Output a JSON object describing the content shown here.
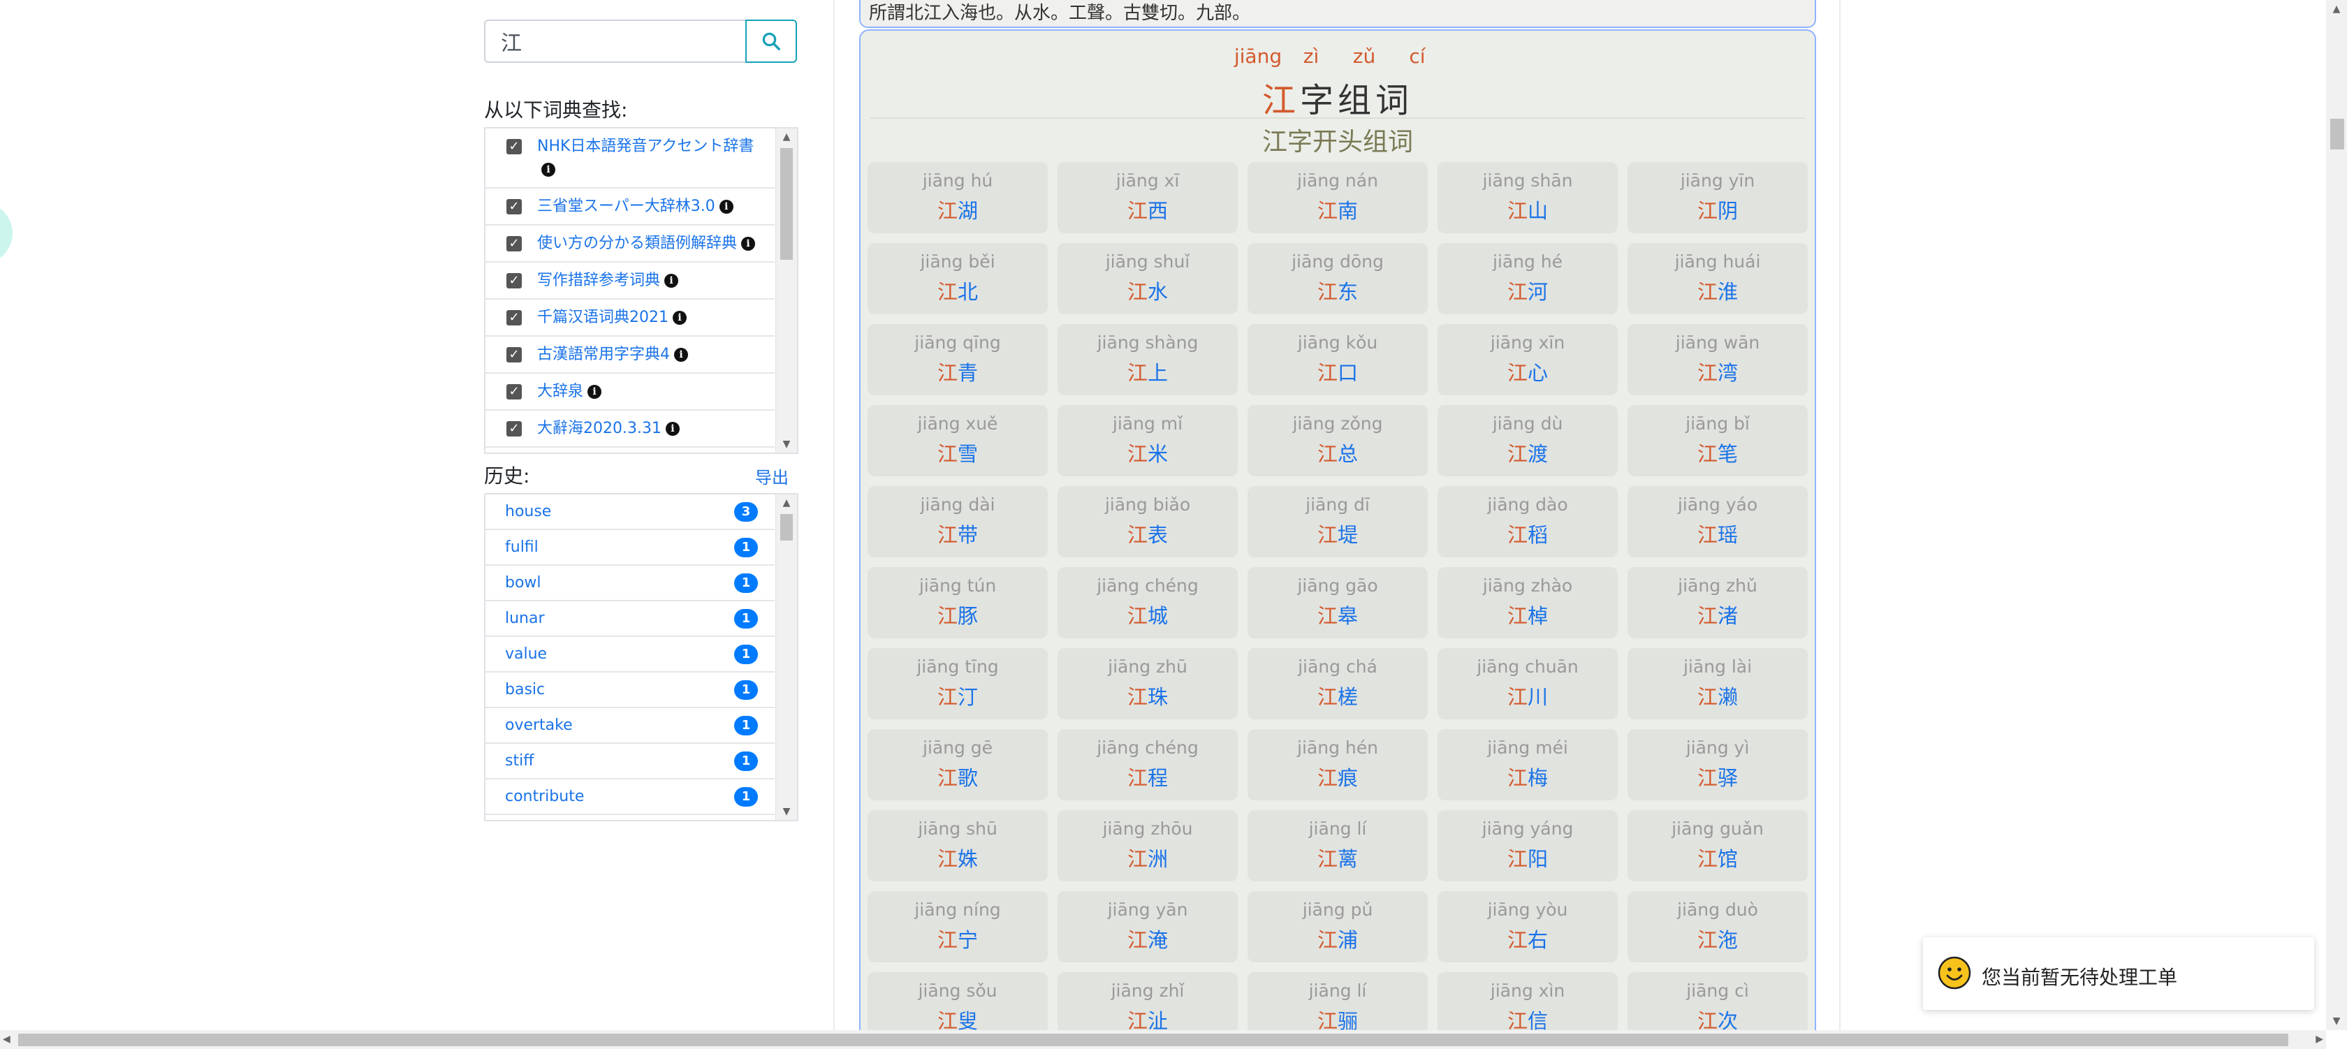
{
  "search": {
    "value": "江",
    "placeholder": "",
    "button_icon": "search-icon"
  },
  "dictionaries": {
    "label": "从以下词典查找:",
    "items": [
      {
        "name": "NHK日本語発音アクセント辞書",
        "checked": true
      },
      {
        "name": "三省堂スーパー大辞林3.0",
        "checked": true
      },
      {
        "name": "使い方の分かる類語例解辞典",
        "checked": true
      },
      {
        "name": "写作措辞参考词典",
        "checked": true
      },
      {
        "name": "千篇汉语词典2021",
        "checked": true
      },
      {
        "name": "古漢語常用字字典4",
        "checked": true
      },
      {
        "name": "大辞泉",
        "checked": true
      },
      {
        "name": "大辭海2020.3.31",
        "checked": true
      }
    ]
  },
  "history": {
    "label": "历史:",
    "export_label": "导出",
    "items": [
      {
        "word": "house",
        "count": "3"
      },
      {
        "word": "fulfil",
        "count": "1"
      },
      {
        "word": "bowl",
        "count": "1"
      },
      {
        "word": "lunar",
        "count": "1"
      },
      {
        "word": "value",
        "count": "1"
      },
      {
        "word": "basic",
        "count": "1"
      },
      {
        "word": "overtake",
        "count": "1"
      },
      {
        "word": "stiff",
        "count": "1"
      },
      {
        "word": "contribute",
        "count": "1"
      }
    ]
  },
  "snippet": {
    "text": "所謂北江入海也。从水。工聲。古雙切。九部。"
  },
  "words_panel": {
    "header_pinyin": [
      "jiāng",
      "zì",
      "zǔ",
      "cí"
    ],
    "title_char": "江",
    "title_rest": "字组词",
    "subtitle": "江字开头组词",
    "words": [
      {
        "pinyin": "jiāng hú",
        "first": "江",
        "rest": "湖"
      },
      {
        "pinyin": "jiāng xī",
        "first": "江",
        "rest": "西"
      },
      {
        "pinyin": "jiāng nán",
        "first": "江",
        "rest": "南"
      },
      {
        "pinyin": "jiāng shān",
        "first": "江",
        "rest": "山"
      },
      {
        "pinyin": "jiāng yīn",
        "first": "江",
        "rest": "阴"
      },
      {
        "pinyin": "jiāng běi",
        "first": "江",
        "rest": "北"
      },
      {
        "pinyin": "jiāng shuǐ",
        "first": "江",
        "rest": "水"
      },
      {
        "pinyin": "jiāng dōng",
        "first": "江",
        "rest": "东"
      },
      {
        "pinyin": "jiāng hé",
        "first": "江",
        "rest": "河"
      },
      {
        "pinyin": "jiāng huái",
        "first": "江",
        "rest": "淮"
      },
      {
        "pinyin": "jiāng qīng",
        "first": "江",
        "rest": "青"
      },
      {
        "pinyin": "jiāng shàng",
        "first": "江",
        "rest": "上"
      },
      {
        "pinyin": "jiāng kǒu",
        "first": "江",
        "rest": "口"
      },
      {
        "pinyin": "jiāng xīn",
        "first": "江",
        "rest": "心"
      },
      {
        "pinyin": "jiāng wān",
        "first": "江",
        "rest": "湾"
      },
      {
        "pinyin": "jiāng xuě",
        "first": "江",
        "rest": "雪"
      },
      {
        "pinyin": "jiāng mǐ",
        "first": "江",
        "rest": "米"
      },
      {
        "pinyin": "jiāng zǒng",
        "first": "江",
        "rest": "总"
      },
      {
        "pinyin": "jiāng dù",
        "first": "江",
        "rest": "渡"
      },
      {
        "pinyin": "jiāng bǐ",
        "first": "江",
        "rest": "笔"
      },
      {
        "pinyin": "jiāng dài",
        "first": "江",
        "rest": "带"
      },
      {
        "pinyin": "jiāng biǎo",
        "first": "江",
        "rest": "表"
      },
      {
        "pinyin": "jiāng dī",
        "first": "江",
        "rest": "堤"
      },
      {
        "pinyin": "jiāng dào",
        "first": "江",
        "rest": "稻"
      },
      {
        "pinyin": "jiāng yáo",
        "first": "江",
        "rest": "瑶"
      },
      {
        "pinyin": "jiāng tún",
        "first": "江",
        "rest": "豚"
      },
      {
        "pinyin": "jiāng chéng",
        "first": "江",
        "rest": "城"
      },
      {
        "pinyin": "jiāng gāo",
        "first": "江",
        "rest": "皋"
      },
      {
        "pinyin": "jiāng zhào",
        "first": "江",
        "rest": "棹"
      },
      {
        "pinyin": "jiāng zhǔ",
        "first": "江",
        "rest": "渚"
      },
      {
        "pinyin": "jiāng tīng",
        "first": "江",
        "rest": "汀"
      },
      {
        "pinyin": "jiāng zhū",
        "first": "江",
        "rest": "珠"
      },
      {
        "pinyin": "jiāng chá",
        "first": "江",
        "rest": "槎"
      },
      {
        "pinyin": "jiāng chuān",
        "first": "江",
        "rest": "川"
      },
      {
        "pinyin": "jiāng lài",
        "first": "江",
        "rest": "濑"
      },
      {
        "pinyin": "jiāng gē",
        "first": "江",
        "rest": "歌"
      },
      {
        "pinyin": "jiāng chéng",
        "first": "江",
        "rest": "程"
      },
      {
        "pinyin": "jiāng hén",
        "first": "江",
        "rest": "痕"
      },
      {
        "pinyin": "jiāng méi",
        "first": "江",
        "rest": "梅"
      },
      {
        "pinyin": "jiāng yì",
        "first": "江",
        "rest": "驿"
      },
      {
        "pinyin": "jiāng shū",
        "first": "江",
        "rest": "姝"
      },
      {
        "pinyin": "jiāng zhōu",
        "first": "江",
        "rest": "洲"
      },
      {
        "pinyin": "jiāng lí",
        "first": "江",
        "rest": "蓠"
      },
      {
        "pinyin": "jiāng yáng",
        "first": "江",
        "rest": "阳"
      },
      {
        "pinyin": "jiāng guǎn",
        "first": "江",
        "rest": "馆"
      },
      {
        "pinyin": "jiāng níng",
        "first": "江",
        "rest": "宁"
      },
      {
        "pinyin": "jiāng yān",
        "first": "江",
        "rest": "淹"
      },
      {
        "pinyin": "jiāng pǔ",
        "first": "江",
        "rest": "浦"
      },
      {
        "pinyin": "jiāng yòu",
        "first": "江",
        "rest": "右"
      },
      {
        "pinyin": "jiāng duò",
        "first": "江",
        "rest": "沲"
      },
      {
        "pinyin": "jiāng sǒu",
        "first": "江",
        "rest": "叟"
      },
      {
        "pinyin": "jiāng zhǐ",
        "first": "江",
        "rest": "沚"
      },
      {
        "pinyin": "jiāng lí",
        "first": "江",
        "rest": "骊"
      },
      {
        "pinyin": "jiāng xìn",
        "first": "江",
        "rest": "信"
      },
      {
        "pinyin": "jiāng cì",
        "first": "江",
        "rest": "次"
      }
    ]
  },
  "toast": {
    "message": "您当前暂无待处理工单",
    "icon": "smiley-icon"
  },
  "colors": {
    "accent_blue": "#1a73e8",
    "highlight_red": "#d35a2e",
    "search_border": "#17a2b8",
    "badge_blue": "#007bff",
    "panel_border": "#8fb4ff"
  }
}
